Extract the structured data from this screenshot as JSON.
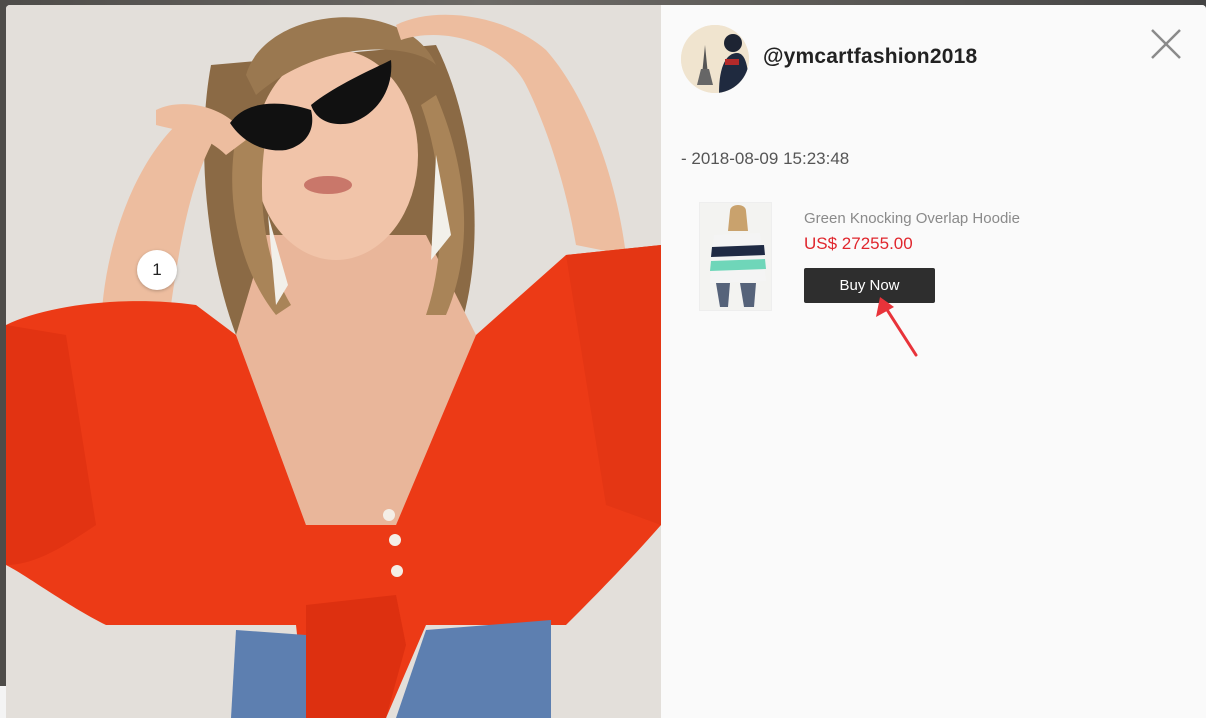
{
  "modal": {
    "photo": {
      "tag_marker": "1",
      "image_icon": "model-photo"
    },
    "user": {
      "avatar_icon": "avatar-image",
      "username": "@ymcartfashion2018"
    },
    "close_icon": "close-icon",
    "post_timestamp": "- 2018-08-09 15:23:48",
    "product": {
      "thumbnail_icon": "product-thumbnail",
      "name": "Green Knocking Overlap Hoodie",
      "price": "US$ 27255.00",
      "buy_label": "Buy Now"
    },
    "annotation_icon": "red-arrow-icon"
  },
  "colors": {
    "price": "#e0262d",
    "button_bg": "#2e2e2e",
    "annotation": "#e8333a",
    "top_red_orange": "#ec3a16"
  }
}
